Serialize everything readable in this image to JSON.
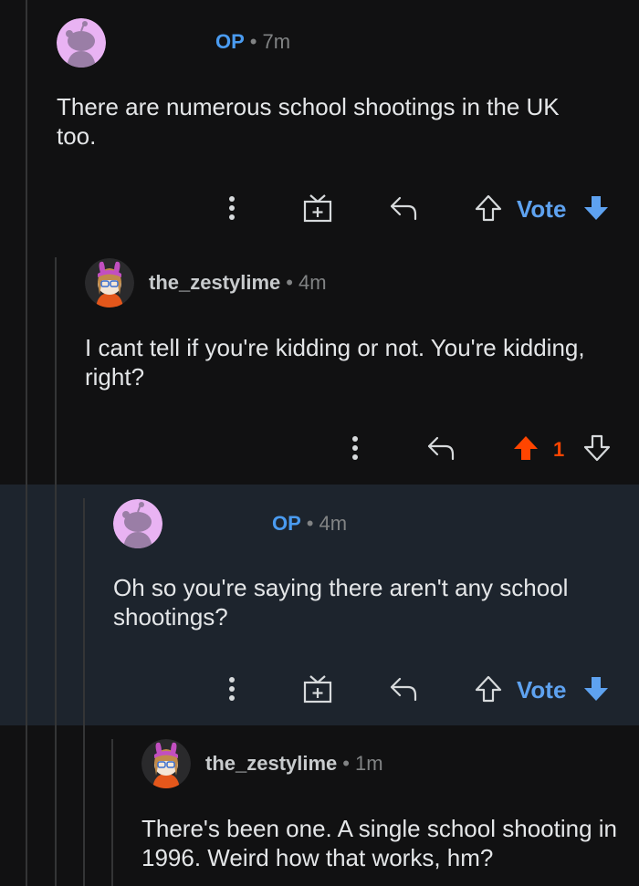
{
  "comments": [
    {
      "author": "OP",
      "time": "7m",
      "text": "There are numerous school shootings in the UK too.",
      "vote_label": "Vote",
      "avatar": "snoo-avatar-icon"
    },
    {
      "author": "the_zestylime",
      "time": "4m",
      "text": "I cant tell if you're kidding or not. You're kidding, right?",
      "score": "1",
      "upvoted": true,
      "avatar": "bunny-ears-avatar-icon"
    },
    {
      "author": "OP",
      "time": "4m",
      "text": "Oh so you're saying there aren't any school shootings?",
      "vote_label": "Vote",
      "highlighted": true,
      "avatar": "snoo-avatar-icon"
    },
    {
      "author": "the_zestylime",
      "time": "1m",
      "text": "There's been one. A single school shooting in 1996. Weird how that works, hm?",
      "avatar": "bunny-ears-avatar-icon"
    }
  ],
  "separator": "•",
  "colors": {
    "background": "#111112",
    "highlight": "#1d242d",
    "op": "#4a9bf0",
    "vote_blue": "#5ea2f0",
    "upvote_orange": "#ff4500",
    "thread_line": "#343536"
  },
  "icons": [
    "more-icon",
    "award-icon",
    "reply-icon",
    "upvote-icon",
    "downvote-icon"
  ]
}
